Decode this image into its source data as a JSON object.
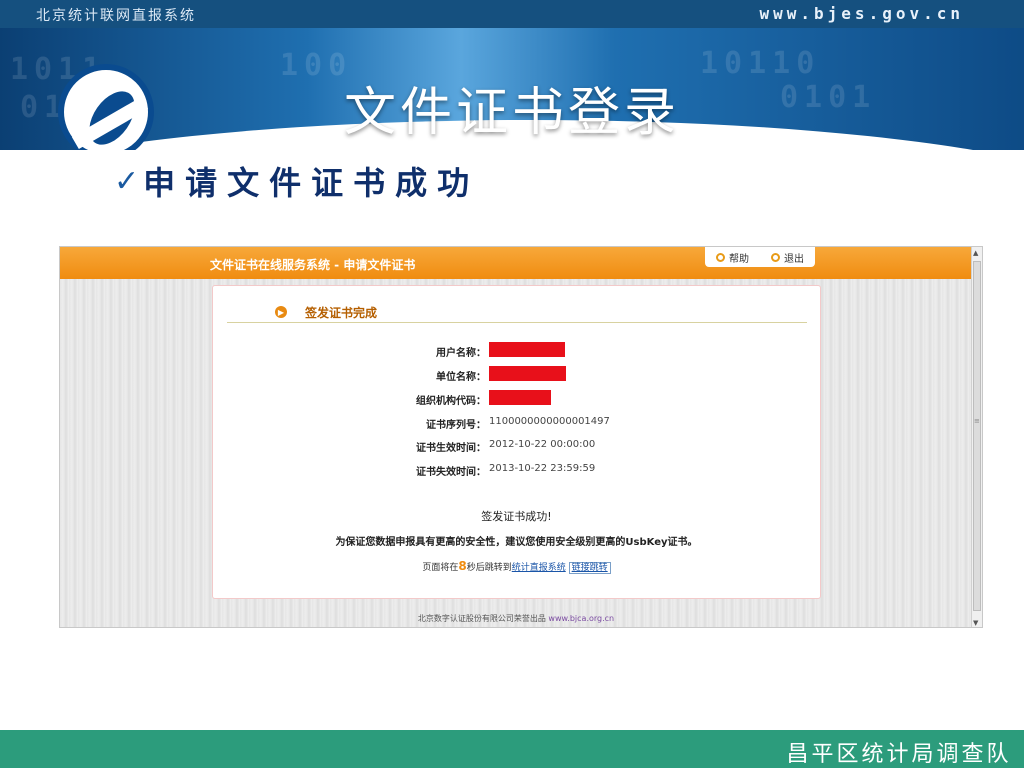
{
  "top_bar": {
    "left_text": "北京统计联网直报系统",
    "right_text": "www.bjes.gov.cn"
  },
  "banner": {
    "title": "文件证书登录"
  },
  "heading": {
    "check_glyph": "✓",
    "text": "申请文件证书成功"
  },
  "screenshot": {
    "header_title": "文件证书在线服务系统 - 申请文件证书",
    "tabs": [
      {
        "label": "帮助",
        "icon": "info-icon"
      },
      {
        "label": "退出",
        "icon": "exit-icon"
      }
    ],
    "section_title": "签发证书完成",
    "fields": [
      {
        "label": "用户名称：",
        "value": "",
        "redacted": true
      },
      {
        "label": "单位名称：",
        "value": "",
        "redacted": true
      },
      {
        "label": "组织机构代码：",
        "value": "",
        "redacted": true
      },
      {
        "label": "证书序列号：",
        "value": "1100000000000001497",
        "redacted": false
      },
      {
        "label": "证书生效时间：",
        "value": "2012-10-22 00:00:00",
        "redacted": false
      },
      {
        "label": "证书失效时间：",
        "value": "2013-10-22 23:59:59",
        "redacted": false
      }
    ],
    "success_msg": "签发证书成功!",
    "advice": "为保证您数据申报具有更高的安全性，建议您使用安全级别更高的UsbKey证书。",
    "redirect": {
      "prefix": "页面将在",
      "seconds": "8",
      "middle": "秒后跳转到",
      "link_text": "统计直报系统",
      "jump_text": "链接跳转"
    },
    "footer": {
      "text": "北京数字认证股份有限公司荣誉出品",
      "link": "www.bjca.org.cn"
    }
  },
  "bottom_bar": {
    "text": "昌平区统计局调查队"
  },
  "colors": {
    "header_orange": "#f08c10",
    "banner_blue": "#1f6fb0",
    "bottom_green": "#2c9c7c",
    "redaction_red": "#e8101a"
  }
}
